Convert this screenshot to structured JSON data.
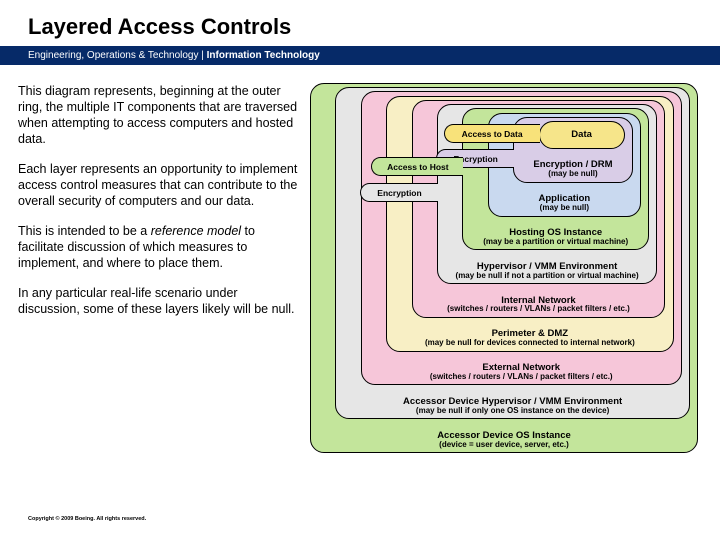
{
  "header": {
    "title": "Layered Access Controls"
  },
  "subbar": {
    "prefix": "Engineering, Operations & Technology | ",
    "bold": "Information Technology"
  },
  "paras": {
    "p1": "This diagram represents, beginning at the outer ring, the multiple IT components that are traversed when attempting to access computers and hosted data.",
    "p2": "Each layer represents an opportunity to implement access control measures that can contribute to the overall security of computers and our data.",
    "p3_a": "This is intended to be a ",
    "p3_i": "reference model",
    "p3_b": " to facilitate discussion of which measures to implement, and where to place them.",
    "p4": "In any particular real-life scenario under discussion, some of these layers likely will be null."
  },
  "rings": [
    {
      "t1": "Accessor Device OS Instance",
      "t2": "(device = user device, server, etc.)",
      "fill": "#c3e59b"
    },
    {
      "t1": "Accessor Device Hypervisor / VMM Environment",
      "t2": "(may be null if only one OS instance on the device)",
      "fill": "#e6e6e6"
    },
    {
      "t1": "External Network",
      "t2": "(switches / routers / VLANs / packet filters / etc.)",
      "fill": "#f6c6d9"
    },
    {
      "t1": "Perimeter & DMZ",
      "t2": "(may be null for devices connected to internal network)",
      "fill": "#f8efc5"
    },
    {
      "t1": "Internal Network",
      "t2": "(switches / routers / VLANs / packet filters / etc.)",
      "fill": "#f6c6d9"
    },
    {
      "t1": "Hypervisor / VMM Environment",
      "t2": "(may be null if not a partition or virtual machine)",
      "fill": "#e6e6e6"
    },
    {
      "t1": "Hosting OS Instance",
      "t2": "(may be a partition or virtual machine)",
      "fill": "#c3e59b"
    },
    {
      "t1": "Application",
      "t2": "(may be null)",
      "fill": "#c9d9ef"
    },
    {
      "t1": "Encryption / DRM",
      "t2": "(may be null)",
      "fill": "#d9cde7"
    },
    {
      "t1": "Data",
      "t2": "",
      "fill": "#f6e58a"
    }
  ],
  "nubs": {
    "encHost": "Encryption",
    "accHost": "Access to Host",
    "encData": "Encryption",
    "accData": "Access to Data"
  },
  "footer": "Copyright © 2009 Boeing. All rights reserved."
}
